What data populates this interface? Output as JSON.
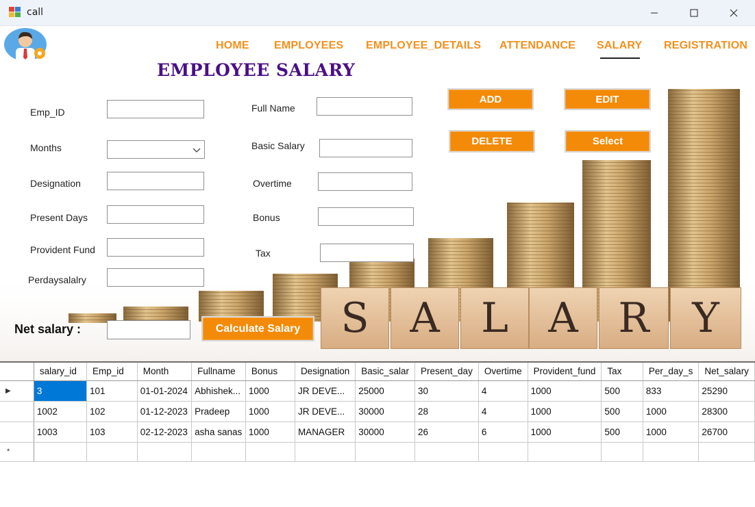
{
  "window": {
    "title": "call",
    "controls": {
      "minimize_icon": "minimize-icon",
      "maximize_icon": "maximize-icon",
      "close_icon": "close-icon"
    }
  },
  "nav": {
    "items": [
      "HOME",
      "EMPLOYEES",
      "EMPLOYEE_DETAILS",
      "ATTENDANCE",
      "SALARY",
      "REGISTRATION"
    ],
    "active": "SALARY"
  },
  "page": {
    "title": "EMPLOYEE SALARY"
  },
  "form": {
    "emp_id": {
      "label": "Emp_ID",
      "value": ""
    },
    "months": {
      "label": "Months",
      "value": ""
    },
    "designation": {
      "label": "Designation",
      "value": ""
    },
    "present_days": {
      "label": "Present Days",
      "value": ""
    },
    "provident_fund": {
      "label": "Provident Fund",
      "value": ""
    },
    "perdaysalary": {
      "label": "Perdaysalalry",
      "value": ""
    },
    "full_name": {
      "label": "Full Name",
      "value": ""
    },
    "basic_salary": {
      "label": "Basic Salary",
      "value": ""
    },
    "overtime": {
      "label": "Overtime",
      "value": ""
    },
    "bonus": {
      "label": "Bonus",
      "value": ""
    },
    "tax": {
      "label": "Tax",
      "value": ""
    },
    "net_salary": {
      "label": "Net salary  :",
      "value": ""
    }
  },
  "buttons": {
    "add": "ADD",
    "edit": "EDIT",
    "delete": "DELETE",
    "select": "Select",
    "calculate": "Calculate Salary"
  },
  "decor": {
    "salary_blocks": [
      "S",
      "A",
      "L",
      "A",
      "R",
      "Y"
    ],
    "accent_color": "#f38a08",
    "title_color": "#4a0f86",
    "nav_color": "#f3901c"
  },
  "grid": {
    "columns": [
      "salary_id",
      "Emp_id",
      "Month",
      "Fullname",
      "Bonus",
      "Designation",
      "Basic_salar",
      "Present_day",
      "Overtime",
      "Provident_fund",
      "Tax",
      "Per_day_s",
      "Net_salary"
    ],
    "rows": [
      [
        "3",
        "101",
        "01-01-2024",
        "Abhishek...",
        "1000",
        "JR DEVE...",
        "25000",
        "30",
        "4",
        "1000",
        "500",
        "833",
        "25290"
      ],
      [
        "1002",
        "102",
        "01-12-2023",
        "Pradeep",
        "1000",
        "JR DEVE...",
        "30000",
        "28",
        "4",
        "1000",
        "500",
        "1000",
        "28300"
      ],
      [
        "1003",
        "103",
        "02-12-2023",
        "asha sanas",
        "1000",
        "MANAGER",
        "30000",
        "26",
        "6",
        "1000",
        "500",
        "1000",
        "26700"
      ]
    ],
    "current_row_marker": "▶",
    "new_row_marker": "*"
  }
}
